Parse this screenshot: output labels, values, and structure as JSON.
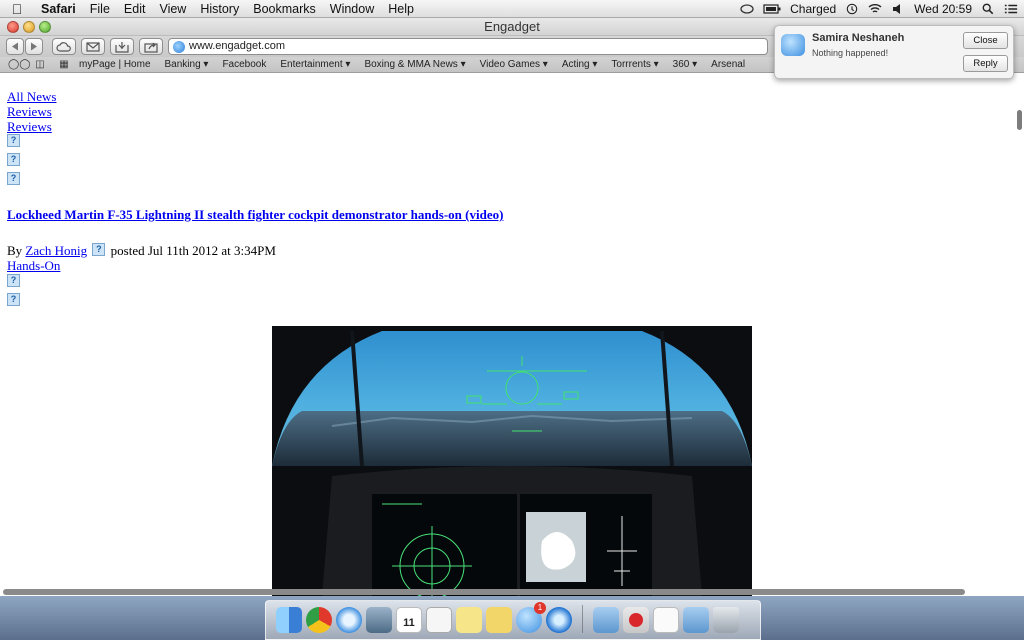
{
  "menubar": {
    "app_name": "Safari",
    "menus": [
      "File",
      "Edit",
      "View",
      "History",
      "Bookmarks",
      "Window",
      "Help"
    ],
    "battery_status": "Charged",
    "clock": "Wed 20:59"
  },
  "window": {
    "title": "Engadget"
  },
  "toolbar": {
    "address": "www.engadget.com"
  },
  "bookmarks": [
    "myPage | Home",
    "Banking ▾",
    "Facebook",
    "Entertainment ▾",
    "Boxing & MMA News ▾",
    "Video Games ▾",
    "Acting ▾",
    "Torrrents ▾",
    "360 ▾",
    "Arsenal"
  ],
  "page": {
    "nav_links": [
      "All News",
      "Reviews",
      "Reviews"
    ],
    "headline": "Lockheed Martin F-35 Lightning II stealth fighter cockpit demonstrator hands-on (video)",
    "byline_prefix": "By",
    "author": "Zach Honig",
    "posted": "posted Jul 11th 2012 at 3:34PM",
    "category": "Hands-On",
    "broken_image_glyph": "?"
  },
  "notification": {
    "sender": "Samira Neshaneh",
    "message": "Nothing happened!",
    "close_label": "Close",
    "reply_label": "Reply"
  },
  "dock": {
    "calendar_day": "11",
    "badge": "1",
    "items": [
      "finder-icon",
      "chrome-icon",
      "safari-icon",
      "preview-icon",
      "calendar-icon",
      "textedit-icon",
      "stickies-icon",
      "notes-icon",
      "messages-icon",
      "itunes-icon",
      "folder-icon",
      "angry-birds-icon",
      "document-icon",
      "downloads-icon",
      "trash-icon"
    ]
  },
  "colors": {
    "link": "#0000ee",
    "hud_green": "#43e36b",
    "sky": "#3ea4d8"
  }
}
